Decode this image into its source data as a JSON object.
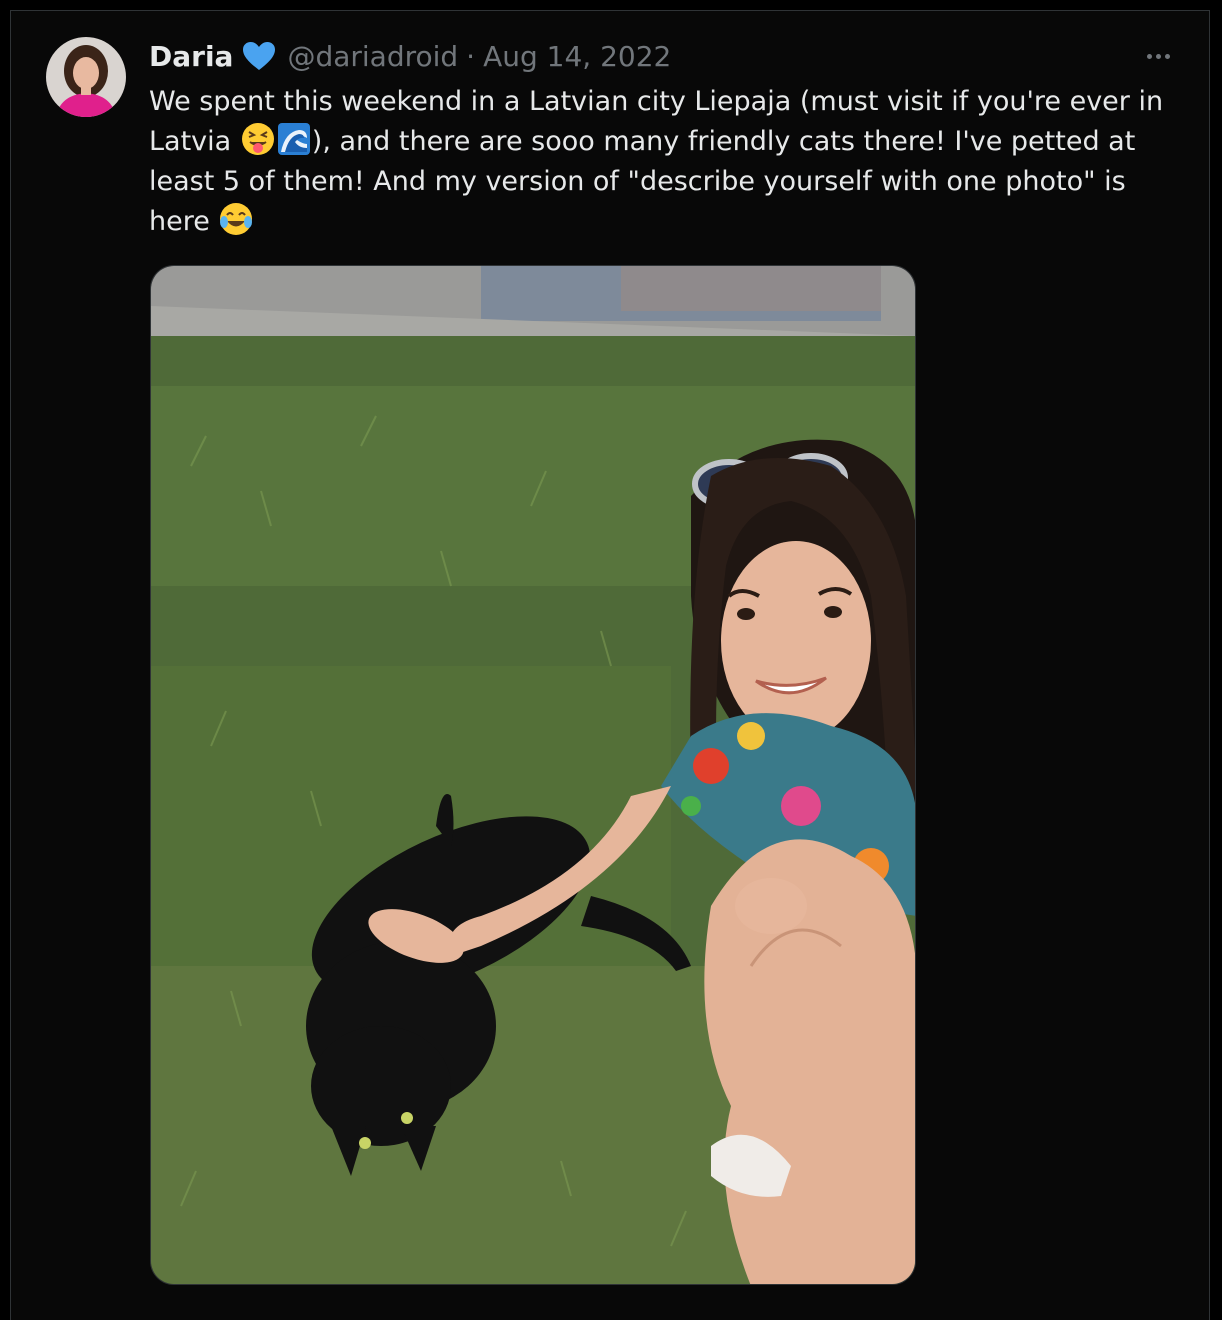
{
  "tweet": {
    "author_name": "Daria",
    "handle": "@dariadroid",
    "separator": "·",
    "date": "Aug 14, 2022",
    "text_line1": "We spent this weekend in a Latvian city Liepaja (must visit if you're ever in",
    "text_line2_before": "Latvia ",
    "text_line2_after": "), and there are sooo many friendly cats there! I've petted at",
    "text_line3": "least 5 of them! And my version of \"describe yourself with one photo\" is",
    "text_line4": "here "
  },
  "icons": {
    "verified": "verified-heart-icon",
    "more": "more-options-icon",
    "emoji1": "squinting-tongue-emoji",
    "emoji2": "water-wave-emoji",
    "emoji3": "tears-of-joy-emoji"
  },
  "colors": {
    "background": "#000000",
    "text": "#e7e9ea",
    "secondary_text": "#71767b",
    "verified_blue": "#4aa3f0"
  }
}
